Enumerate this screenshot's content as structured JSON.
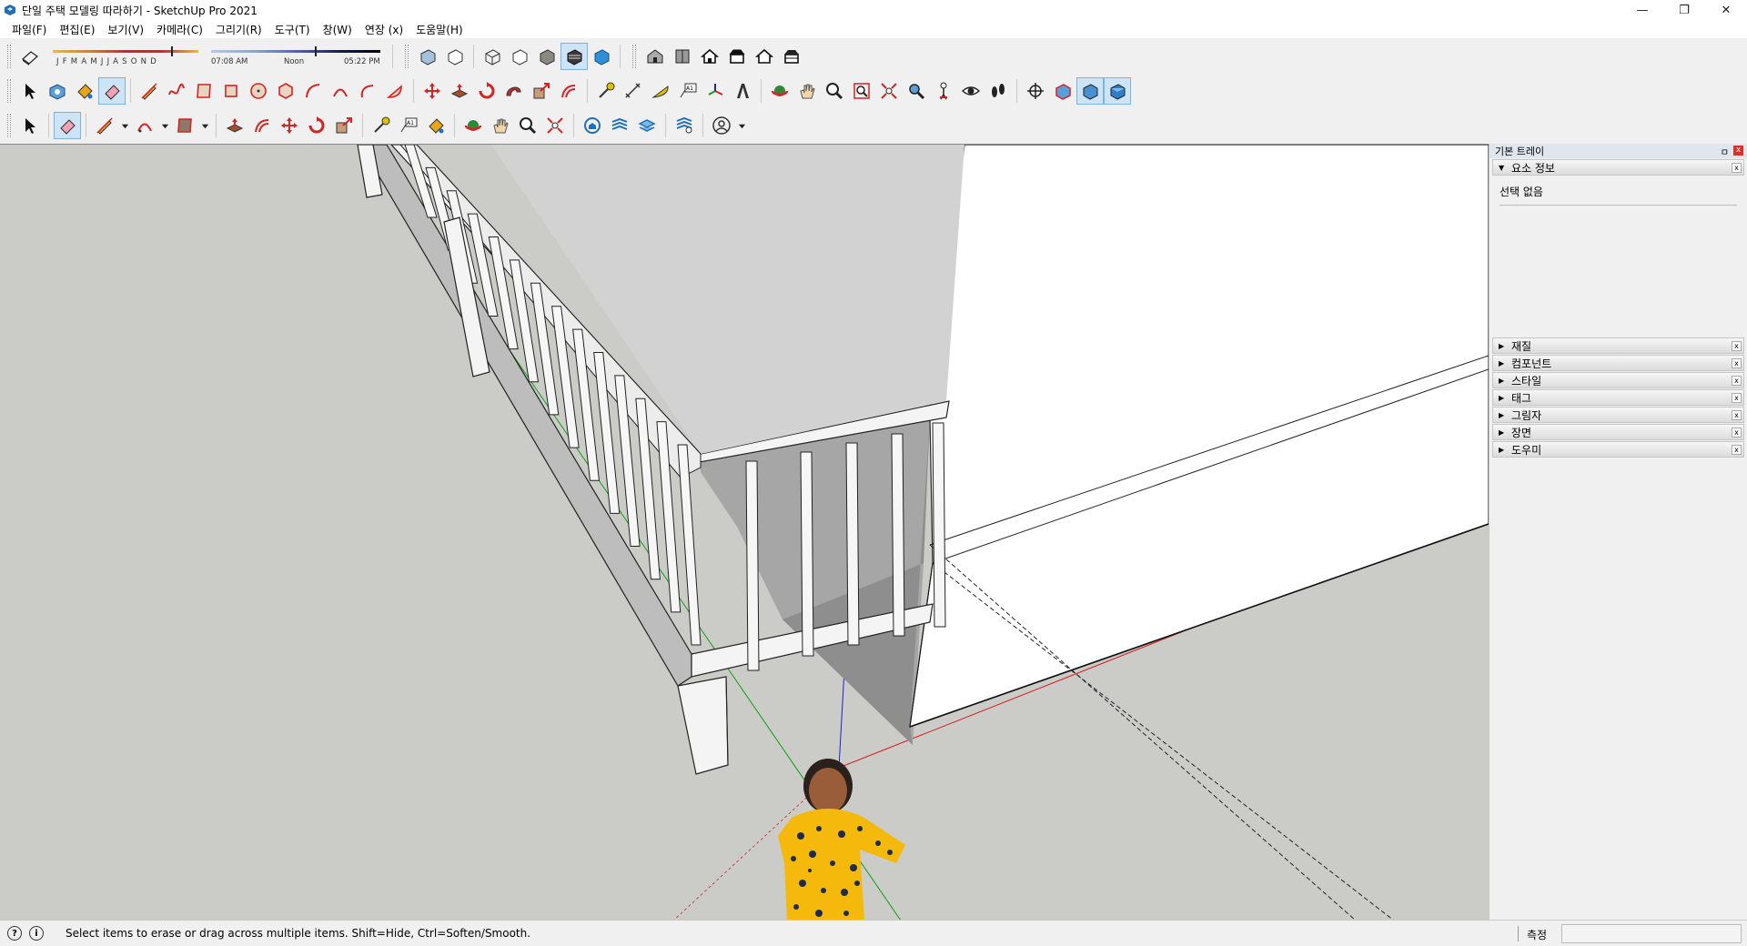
{
  "window": {
    "title": "단일 주택 모델링 따라하기 - SketchUp Pro 2021",
    "minimize_glyph": "—",
    "restore_glyph": "❐",
    "close_glyph": "✕"
  },
  "menu": [
    "파일(F)",
    "편집(E)",
    "보기(V)",
    "카메라(C)",
    "그리기(R)",
    "도구(T)",
    "창(W)",
    "연장 (x)",
    "도움말(H)"
  ],
  "shadows": {
    "months": "JFMAMJJASOND",
    "time_start": "07:08 AM",
    "time_mid": "Noon",
    "time_end": "05:22 PM",
    "date_position": 0.85,
    "time_position": 0.62
  },
  "tray": {
    "title": "기본 트레이",
    "pin_glyph": "ㅁ",
    "close_glyph": "x",
    "entity_info": {
      "label": "요소 정보",
      "selection": "선택 없음",
      "expanded_glyph": "▼"
    },
    "collapsed_glyph": "▶",
    "panels": [
      "재질",
      "컴포넌트",
      "스타일",
      "태그",
      "그림자",
      "장면",
      "도우미"
    ]
  },
  "status": {
    "message": "Select items to erase or drag across multiple items. Shift=Hide, Ctrl=Soften/Smooth.",
    "measure_label": "측정",
    "measure_value": "",
    "help_glyph": "?",
    "info_glyph": "i"
  },
  "colors": {
    "accent_active": "#cde4f7",
    "axis_red": "#d02020",
    "axis_green": "#10a010",
    "axis_blue": "#2020d0",
    "ground": "#cbcbc8",
    "tool_red": "#d42424"
  }
}
